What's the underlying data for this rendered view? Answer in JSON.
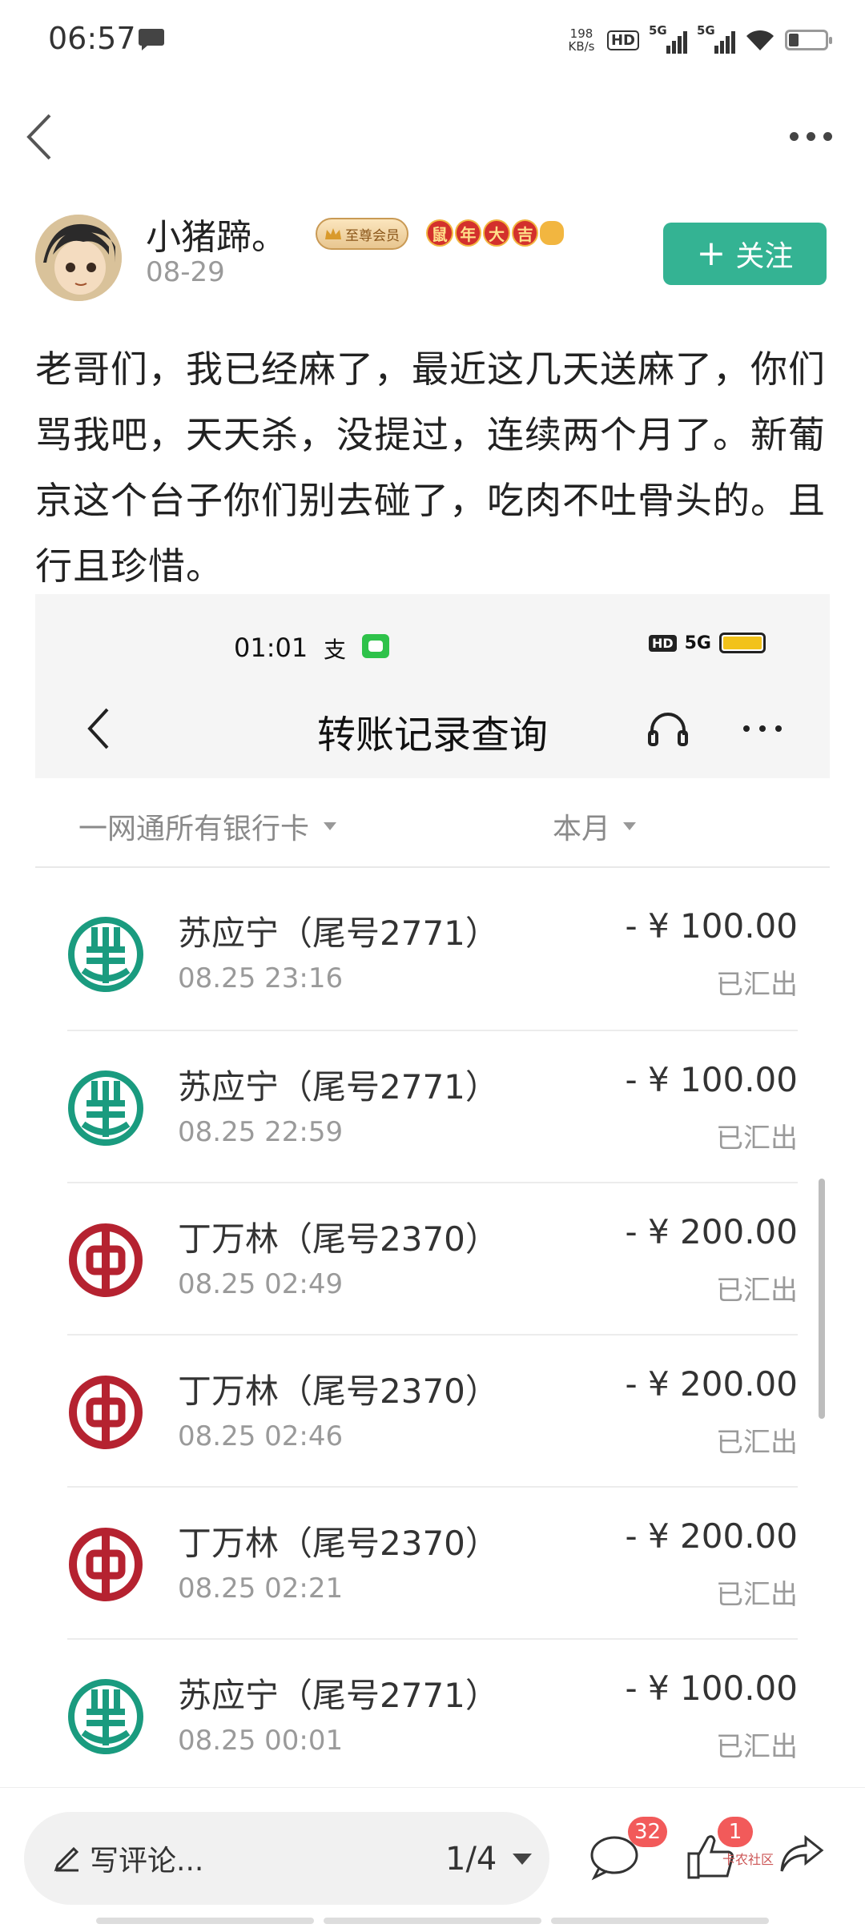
{
  "status_bar": {
    "time": "06:57",
    "net_speed_value": "198",
    "net_speed_unit": "KB/s",
    "hd_label": "HD",
    "signal_1": "5G",
    "signal_2": "5G"
  },
  "post": {
    "author": "小猪蹄。",
    "date": "08-29",
    "vip_badge": "至尊会员",
    "year_badge": [
      "鼠",
      "年",
      "大",
      "吉"
    ],
    "follow_label": "关注",
    "text": "老哥们，我已经麻了，最近这几天送麻了，你们骂我吧，天天杀，没提过，连续两个月了。新葡京这个台子你们别去碰了，吃肉不吐骨头的。且行且珍惜。"
  },
  "embedded_screenshot": {
    "status_time": "01:01",
    "status_app_icon": "支",
    "status_hd": "HD",
    "status_signal": "5G",
    "title": "转账记录查询",
    "filter_card": "一网通所有银行卡",
    "filter_month": "本月",
    "transfers": [
      {
        "bank": "abc",
        "name": "苏应宁（尾号2771）",
        "time": "08.25 23:16",
        "amount": "- ¥ 100.00",
        "status": "已汇出"
      },
      {
        "bank": "abc",
        "name": "苏应宁（尾号2771）",
        "time": "08.25 22:59",
        "amount": "- ¥ 100.00",
        "status": "已汇出"
      },
      {
        "bank": "boc",
        "name": "丁万林（尾号2370）",
        "time": "08.25 02:49",
        "amount": "- ¥ 200.00",
        "status": "已汇出"
      },
      {
        "bank": "boc",
        "name": "丁万林（尾号2370）",
        "time": "08.25 02:46",
        "amount": "- ¥ 200.00",
        "status": "已汇出"
      },
      {
        "bank": "boc",
        "name": "丁万林（尾号2370）",
        "time": "08.25 02:21",
        "amount": "- ¥ 200.00",
        "status": "已汇出"
      },
      {
        "bank": "abc",
        "name": "苏应宁（尾号2771）",
        "time": "08.25 00:01",
        "amount": "- ¥ 100.00",
        "status": "已汇出"
      }
    ]
  },
  "bottom_bar": {
    "comment_placeholder": "写评论...",
    "page_indicator": "1/4",
    "comment_count": "32",
    "like_count": "1",
    "watermark": "卡农社区"
  },
  "colors": {
    "follow_green": "#34b393",
    "abc_green": "#1a9b7f",
    "boc_red": "#b52230",
    "badge_red": "#f25a5a"
  }
}
